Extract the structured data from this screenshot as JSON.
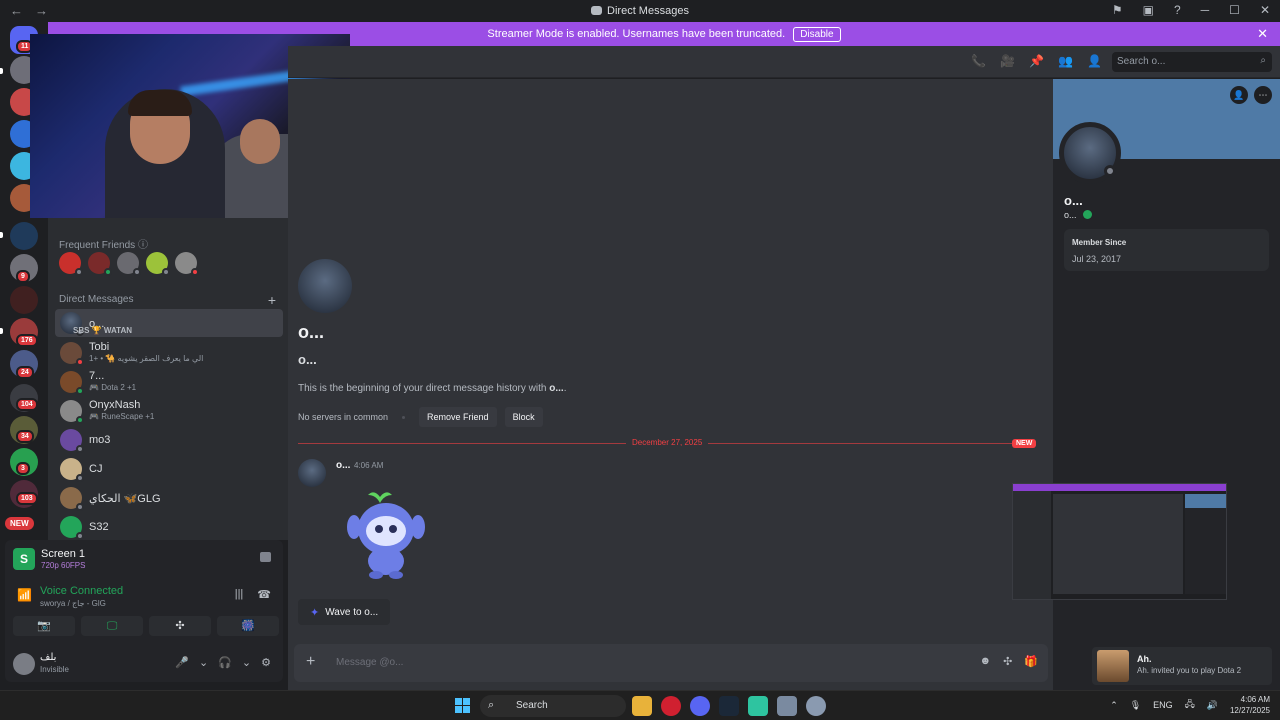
{
  "window": {
    "title": "Direct Messages",
    "nav_back": "←",
    "nav_forward": "→",
    "controls": [
      "⚑",
      "▣",
      "?",
      "─",
      "☐",
      "✕"
    ]
  },
  "streamer_banner": {
    "text": "Streamer Mode is enabled. Usernames have been truncated.",
    "disable_label": "Disable",
    "close": "✕"
  },
  "server_rail": {
    "badges": [
      "11",
      "9",
      "176",
      "24",
      "104",
      "34",
      "3",
      "103"
    ],
    "new_label": "NEW"
  },
  "sidebar": {
    "frequent_friends_label": "Frequent Friends",
    "direct_messages_label": "Direct Messages",
    "add_dm": "+",
    "dms": [
      {
        "name": "o...",
        "sub": "",
        "overlay": "SBS 🏆 WATAN"
      },
      {
        "name": "Tobi",
        "sub": "الي ما يعرف الصقر يشويه 🐪 • +1"
      },
      {
        "name": "7...",
        "sub": "Dota 2 +1"
      },
      {
        "name": "OnyxNash",
        "sub": "RuneScape +1"
      },
      {
        "name": "mo3",
        "sub": ""
      },
      {
        "name": "CJ",
        "sub": ""
      },
      {
        "name": "الحكاي 🦋GLG",
        "sub": ""
      },
      {
        "name": "S32",
        "sub": ""
      }
    ]
  },
  "screen_panel": {
    "title": "Screen 1",
    "sub": "720p 60FPS",
    "icon_letter": "S"
  },
  "voice_panel": {
    "title": "Voice Connected",
    "sub": "sworya / جاج - GlG",
    "buttons": [
      "📷",
      "🖵",
      "✣",
      "🎆"
    ]
  },
  "user_panel": {
    "name": "بلف",
    "status": "Invisible",
    "controls": [
      "🎤",
      "⌄",
      "🎧",
      "⌄",
      "⚙"
    ]
  },
  "chat_header": {
    "search_placeholder": "Search o...",
    "icons": [
      "📞",
      "🎥",
      "📌",
      "👥",
      "👤"
    ]
  },
  "chat": {
    "display_name": "o...",
    "username": "o...",
    "beginning_text": "This is the beginning of your direct message history with ",
    "beginning_name": "o...",
    "beginning_end": ".",
    "no_servers": "No servers in common",
    "remove_friend": "Remove Friend",
    "block": "Block",
    "divider_date": "December 27, 2025",
    "new_tag": "NEW",
    "message_author": "o...",
    "message_time": "4:06 AM",
    "wave_label": "Wave to o...",
    "composer_placeholder": "Message @o..."
  },
  "profile": {
    "display_name": "o...",
    "username": "o...",
    "member_since_label": "Member Since",
    "member_since": "Jul 23, 2017"
  },
  "toast": {
    "name": "Ah.",
    "message": "Ah. invited you to play Dota 2"
  },
  "taskbar": {
    "search_label": "Search",
    "language": "ENG",
    "time": "4:06 AM",
    "date": "12/27/2025"
  },
  "colors": {
    "banner": "#9b4ee5",
    "online": "#23a55a",
    "danger": "#f23f43",
    "blurple": "#5865f2"
  }
}
